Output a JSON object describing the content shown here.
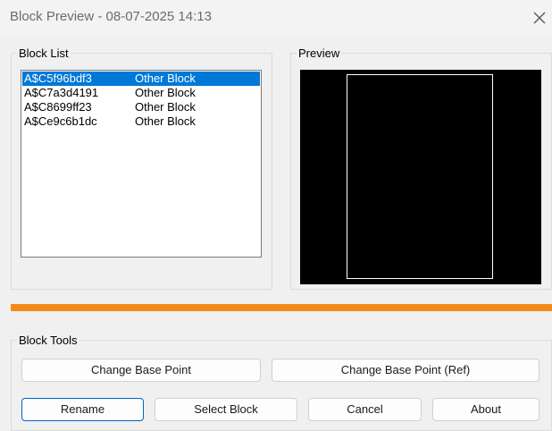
{
  "window": {
    "title": "Block Preview - 08-07-2025 14:13",
    "close_icon": "close-icon"
  },
  "block_list": {
    "label": "Block List",
    "items": [
      {
        "name": "A$C5f96bdf3",
        "type": "Other Block",
        "selected": true
      },
      {
        "name": "A$C7a3d4191",
        "type": "Other Block",
        "selected": false
      },
      {
        "name": "A$C8699ff23",
        "type": "Other Block",
        "selected": false
      },
      {
        "name": "A$Ce9c6b1dc",
        "type": "Other Block",
        "selected": false
      }
    ]
  },
  "preview": {
    "label": "Preview"
  },
  "colors": {
    "accent_bar": "#f28a1a",
    "selection": "#0078d7"
  },
  "tools": {
    "label": "Block Tools",
    "change_base_point": "Change Base Point",
    "change_base_point_ref": "Change Base Point (Ref)",
    "rename": "Rename",
    "select_block": "Select Block",
    "cancel": "Cancel",
    "about": "About"
  }
}
